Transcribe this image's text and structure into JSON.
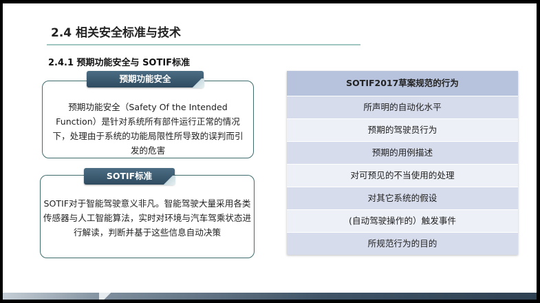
{
  "slide": {
    "title": "2.4 相关安全标准与技术",
    "subtitle": "2.4.1 预期功能安全与 SOTIF标准"
  },
  "cards": [
    {
      "tag": "预期功能安全",
      "text": "预期功能安全（Safety Of the Intended Function）是针对系统所有部件运行正常的情况下，处理由于系统的功能局限性所导致的误判而引发的危害"
    },
    {
      "tag": "SOTIF标准",
      "text": "SOTIF对于智能驾驶意义非凡。智能驾驶大量采用各类传感器与人工智能算法，实时对环境与汽车驾乘状态进行解读，判断并基于这些信息自动决策"
    }
  ],
  "table": {
    "header": "SOTIF2017草案规范的行为",
    "rows": [
      "所声明的自动化水平",
      "预期的驾驶员行为",
      "预期的用例描述",
      "对可预见的不当使用的处理",
      "对其它系统的假设",
      "(自动驾驶操作的）触发事件",
      "所规范行为的目的"
    ]
  },
  "colors": {
    "tag": "#3b5a70",
    "table_header": "#b7c3dc",
    "row_dark": "#d6dcec",
    "row_light": "#edf0f7",
    "card_border": "#3e6b6c",
    "title_rule": "#9fc6c0"
  }
}
